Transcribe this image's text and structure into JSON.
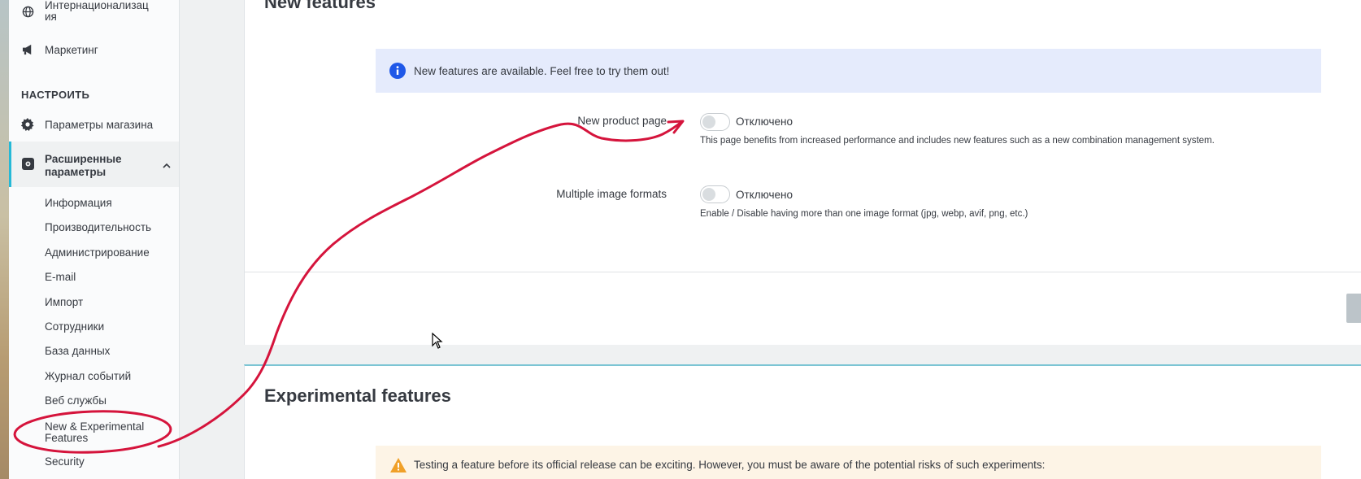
{
  "sidebar": {
    "items": [
      {
        "label": "Интернационализац\nия",
        "icon": "globe-icon"
      },
      {
        "label": "Маркетинг",
        "icon": "megaphone-icon"
      }
    ],
    "section_title": "НАСТРОИТЬ",
    "shop_params": {
      "label": "Параметры магазина",
      "icon": "gear-icon"
    },
    "advanced": {
      "label": "Расширенные\nпараметры",
      "icon": "advanced-settings-icon",
      "chevron": "chevron-up-icon"
    },
    "sub_items": [
      "Информация",
      "Производительность",
      "Администрирование",
      "E-mail",
      "Импорт",
      "Сотрудники",
      "База данных",
      "Журнал событий",
      "Веб службы",
      "New & Experimental\nFeatures",
      "Security"
    ]
  },
  "new_features": {
    "title": "New features",
    "info_text": "New features are available. Feel free to try them out!",
    "rows": [
      {
        "label": "New product page",
        "toggle_state": "Отключено",
        "help": "This page benefits from increased performance and includes new features such as a new combination management system."
      },
      {
        "label": "Multiple image formats",
        "toggle_state": "Отключено",
        "help": "Enable / Disable having more than one image format (jpg, webp, avif, png, etc.)"
      }
    ]
  },
  "experimental": {
    "title": "Experimental features",
    "warning_text": "Testing a feature before its official release can be exciting. However, you must be aware of the potential risks of such experiments:"
  },
  "colors": {
    "accent": "#25b9d7",
    "info_bg": "#e5ebfc",
    "info_icon": "#1f58e8",
    "warning_bg": "#fdf4e6",
    "warning_icon": "#f0a028",
    "annotation": "#d5143c"
  }
}
